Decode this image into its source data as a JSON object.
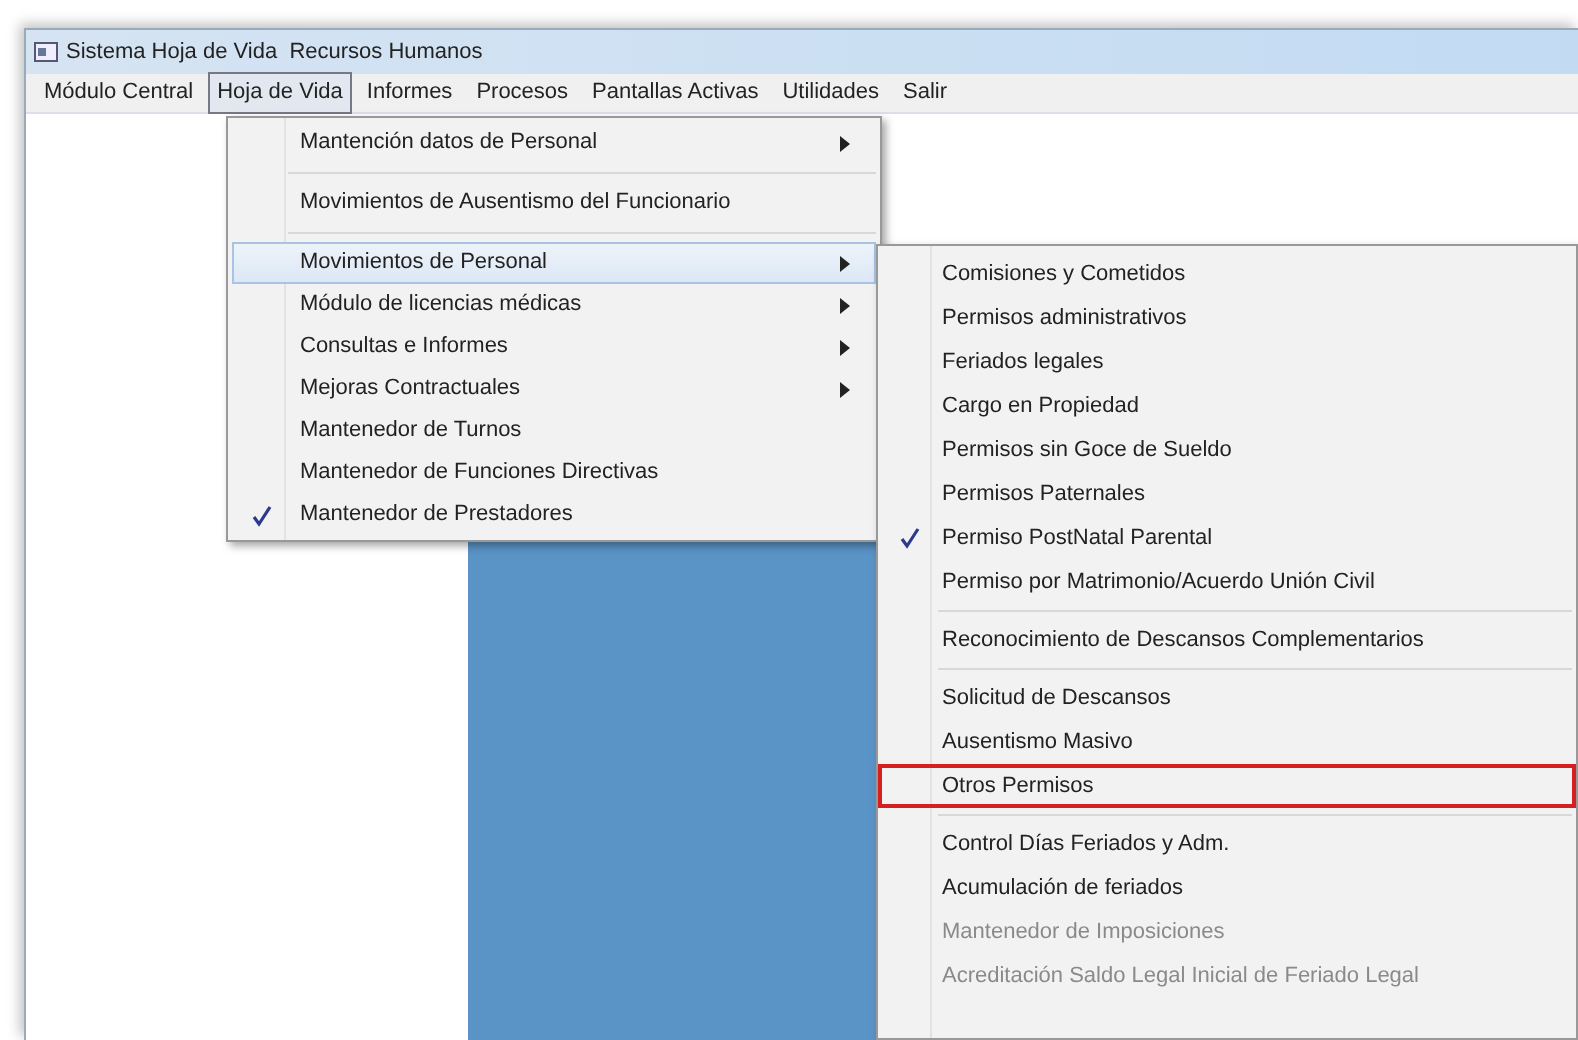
{
  "window": {
    "title": "Sistema Hoja de Vida  Recursos Humanos"
  },
  "menubar": [
    {
      "label": "Módulo Central",
      "selected": false
    },
    {
      "label": "Hoja de Vida",
      "selected": true
    },
    {
      "label": "Informes",
      "selected": false
    },
    {
      "label": "Procesos",
      "selected": false
    },
    {
      "label": "Pantallas Activas",
      "selected": false
    },
    {
      "label": "Utilidades",
      "selected": false
    },
    {
      "label": "Salir",
      "selected": false
    }
  ],
  "menu": [
    {
      "kind": "item",
      "label": "Mantención datos de Personal",
      "submenu": true,
      "selected": false,
      "checked": false
    },
    {
      "kind": "separator"
    },
    {
      "kind": "item",
      "label": "Movimientos de Ausentismo del Funcionario",
      "submenu": false,
      "selected": false,
      "checked": false
    },
    {
      "kind": "separator"
    },
    {
      "kind": "item",
      "label": "Movimientos de Personal",
      "submenu": true,
      "selected": true,
      "checked": false
    },
    {
      "kind": "item",
      "label": "Módulo de licencias médicas",
      "submenu": true,
      "selected": false,
      "checked": false
    },
    {
      "kind": "item",
      "label": "Consultas e Informes",
      "submenu": true,
      "selected": false,
      "checked": false
    },
    {
      "kind": "item",
      "label": "Mejoras Contractuales",
      "submenu": true,
      "selected": false,
      "checked": false
    },
    {
      "kind": "item",
      "label": "Mantenedor de Turnos",
      "submenu": false,
      "selected": false,
      "checked": false
    },
    {
      "kind": "item",
      "label": "Mantenedor de Funciones Directivas",
      "submenu": false,
      "selected": false,
      "checked": false
    },
    {
      "kind": "item",
      "label": "Mantenedor de Prestadores",
      "submenu": false,
      "selected": false,
      "checked": true
    }
  ],
  "submenu": [
    {
      "kind": "item",
      "label": "Comisiones y Cometidos",
      "checked": false,
      "disabled": false,
      "highlighted": false
    },
    {
      "kind": "item",
      "label": "Permisos administrativos",
      "checked": false,
      "disabled": false,
      "highlighted": false
    },
    {
      "kind": "item",
      "label": "Feriados legales",
      "checked": false,
      "disabled": false,
      "highlighted": false
    },
    {
      "kind": "item",
      "label": "Cargo en Propiedad",
      "checked": false,
      "disabled": false,
      "highlighted": false
    },
    {
      "kind": "item",
      "label": "Permisos sin Goce de Sueldo",
      "checked": false,
      "disabled": false,
      "highlighted": false
    },
    {
      "kind": "item",
      "label": "Permisos Paternales",
      "checked": false,
      "disabled": false,
      "highlighted": false
    },
    {
      "kind": "item",
      "label": "Permiso PostNatal Parental",
      "checked": true,
      "disabled": false,
      "highlighted": false
    },
    {
      "kind": "item",
      "label": "Permiso por Matrimonio/Acuerdo Unión Civil",
      "checked": false,
      "disabled": false,
      "highlighted": false
    },
    {
      "kind": "separator"
    },
    {
      "kind": "item",
      "label": "Reconocimiento de Descansos Complementarios",
      "checked": false,
      "disabled": false,
      "highlighted": false
    },
    {
      "kind": "separator"
    },
    {
      "kind": "item",
      "label": "Solicitud de Descansos",
      "checked": false,
      "disabled": false,
      "highlighted": false
    },
    {
      "kind": "item",
      "label": "Ausentismo Masivo",
      "checked": false,
      "disabled": false,
      "highlighted": false
    },
    {
      "kind": "item",
      "label": "Otros Permisos",
      "checked": false,
      "disabled": false,
      "highlighted": true
    },
    {
      "kind": "separator"
    },
    {
      "kind": "item",
      "label": "Control Días Feriados y Adm.",
      "checked": false,
      "disabled": false,
      "highlighted": false
    },
    {
      "kind": "item",
      "label": "Acumulación de feriados",
      "checked": false,
      "disabled": false,
      "highlighted": false
    },
    {
      "kind": "item",
      "label": "Mantenedor de Imposiciones",
      "checked": false,
      "disabled": true,
      "highlighted": false
    },
    {
      "kind": "item",
      "label": "Acreditación Saldo Legal Inicial de Feriado Legal",
      "checked": false,
      "disabled": true,
      "highlighted": false
    }
  ]
}
